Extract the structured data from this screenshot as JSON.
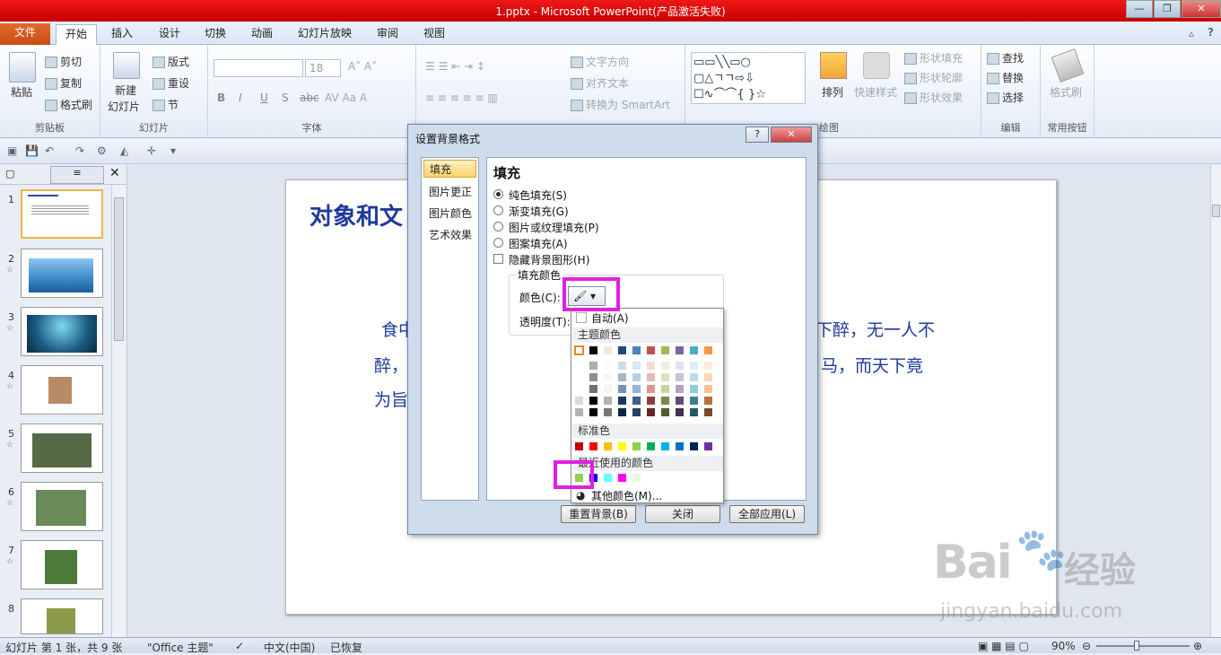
{
  "app": {
    "window_title": "1.pptx - Microsoft PowerPoint(产品激活失败)",
    "window_buttons": [
      "—",
      "❐",
      "✕"
    ]
  },
  "tabs": [
    {
      "label": "文件"
    },
    {
      "label": "开始"
    },
    {
      "label": "插入"
    },
    {
      "label": "设计"
    },
    {
      "label": "切换"
    },
    {
      "label": "动画"
    },
    {
      "label": "幻灯片放映"
    },
    {
      "label": "审阅"
    },
    {
      "label": "视图"
    }
  ],
  "ribbon": {
    "clipboard": {
      "paste": "粘贴",
      "cut": "剪切",
      "copy": "复制",
      "format_painter": "格式刷",
      "label": "剪贴板"
    },
    "slides": {
      "new_slide_1": "新建",
      "new_slide_2": "幻灯片",
      "layout": "版式",
      "reset": "重设",
      "section": "节",
      "label": "幻灯片"
    },
    "font": {
      "font_size": "18",
      "label": "字体",
      "bold": "B",
      "italic": "I",
      "underline": "U",
      "shadow": "S",
      "strike": "abc"
    },
    "paragraph": {
      "text_direction": "文字方向",
      "align_text": "对齐文本",
      "smartart": "转换为 SmartArt"
    },
    "drawing": {
      "arrange": "排列",
      "quick_styles": "快速样式",
      "shape_fill": "形状填充",
      "shape_outline": "形状轮廓",
      "shape_effects": "形状效果",
      "label": "绘图"
    },
    "editing": {
      "find": "查找",
      "replace": "替换",
      "select": "选择",
      "label": "编辑"
    },
    "common": {
      "format_painter": "格式刷",
      "label": "常用按钮"
    }
  },
  "slides_panel": {
    "items": [
      {
        "num": "1"
      },
      {
        "num": "2"
      },
      {
        "num": "3"
      },
      {
        "num": "4"
      },
      {
        "num": "5"
      },
      {
        "num": "6"
      },
      {
        "num": "7"
      },
      {
        "num": "8"
      }
    ]
  },
  "slide": {
    "title": "对象和文",
    "line1_left": "食中",
    "line1_right": "下醉，无一人不",
    "line2_left": "醉，",
    "line2_right": "马，而天下竟",
    "line3_left": "为旨"
  },
  "dialog": {
    "title": "设置背景格式",
    "help": "?",
    "close": "✕",
    "nav": [
      "填充",
      "图片更正",
      "图片颜色",
      "艺术效果"
    ],
    "section_title": "填充",
    "options": [
      "纯色填充(S)",
      "渐变填充(G)",
      "图片或纹理填充(P)",
      "图案填充(A)"
    ],
    "hide_bg": "隐藏背景图形(H)",
    "fill_color_group": "填充颜色",
    "color_label": "颜色(C):",
    "transparency_label": "透明度(T):",
    "buttons": {
      "reset": "重置背景(B)",
      "close": "关闭",
      "apply_all": "全部应用(L)"
    }
  },
  "color_popup": {
    "auto": "自动(A)",
    "theme_header": "主题颜色",
    "standard_header": "标准色",
    "recent_header": "最近使用的颜色",
    "more": "其他颜色(M)...",
    "theme_top": [
      "#ffffff",
      "#000000",
      "#eeece1",
      "#1f497d",
      "#4f81bd",
      "#c0504d",
      "#9bbb59",
      "#8064a2",
      "#4bacc6",
      "#f79646"
    ],
    "standard": [
      "#c00000",
      "#ff0000",
      "#ffc000",
      "#ffff00",
      "#92d050",
      "#00b050",
      "#00b0f0",
      "#0070c0",
      "#002060",
      "#7030a0"
    ],
    "recent": [
      "#92d050",
      "#0000ff",
      "#66ffff",
      "#ff00ff",
      "#e6f7e6"
    ]
  },
  "status": {
    "slide_info": "幻灯片 第 1 张，共 9 张",
    "theme": "\"Office 主题\"",
    "language": "中文(中国)",
    "recovered": "已恢复",
    "zoom": "90%"
  },
  "watermark": {
    "brand": "Bai",
    "brand2": "经验",
    "url": "jingyan.baidu.com"
  }
}
